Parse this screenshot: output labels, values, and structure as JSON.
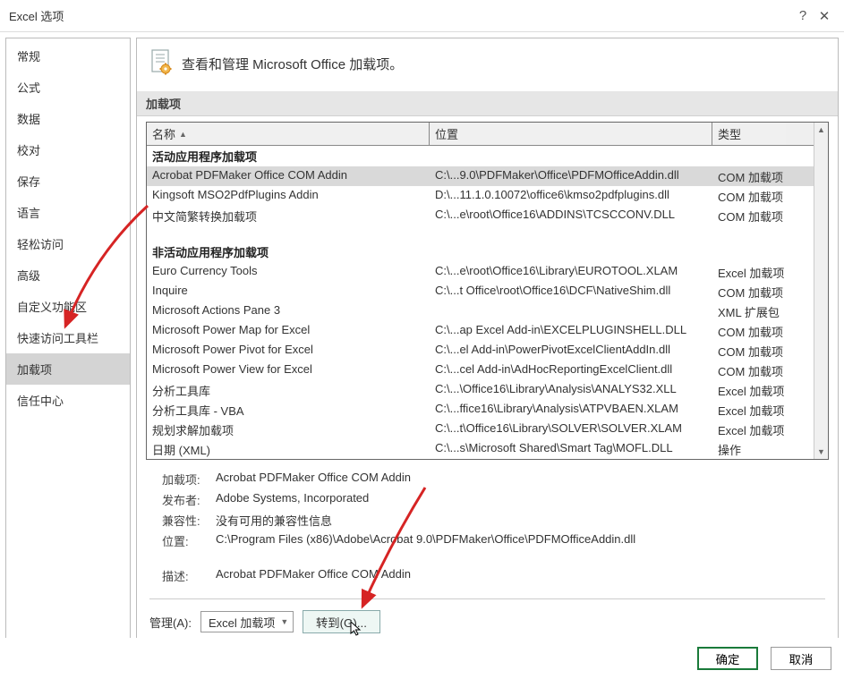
{
  "window": {
    "title": "Excel 选项",
    "help": "?",
    "close": "✕"
  },
  "sidebar": {
    "items": [
      {
        "label": "常规"
      },
      {
        "label": "公式"
      },
      {
        "label": "数据"
      },
      {
        "label": "校对"
      },
      {
        "label": "保存"
      },
      {
        "label": "语言"
      },
      {
        "label": "轻松访问"
      },
      {
        "label": "高级"
      },
      {
        "label": "自定义功能区"
      },
      {
        "label": "快速访问工具栏"
      },
      {
        "label": "加载项",
        "selected": true
      },
      {
        "label": "信任中心"
      }
    ]
  },
  "heading": "查看和管理 Microsoft Office 加载项。",
  "section_label": "加载项",
  "columns": {
    "name": "名称",
    "loc": "位置",
    "type": "类型",
    "sort": "▲"
  },
  "groups": [
    {
      "title": "活动应用程序加载项",
      "rows": [
        {
          "name": "Acrobat PDFMaker Office COM Addin",
          "loc": "C:\\...9.0\\PDFMaker\\Office\\PDFMOfficeAddin.dll",
          "type": "COM 加载项",
          "selected": true
        },
        {
          "name": "Kingsoft MSO2PdfPlugins Addin",
          "loc": "D:\\...11.1.0.10072\\office6\\kmso2pdfplugins.dll",
          "type": "COM 加载项"
        },
        {
          "name": "中文简繁转换加载项",
          "loc": "C:\\...e\\root\\Office16\\ADDINS\\TCSCCONV.DLL",
          "type": "COM 加载项"
        }
      ]
    },
    {
      "title": "非活动应用程序加载项",
      "rows": [
        {
          "name": "Euro Currency Tools",
          "loc": "C:\\...e\\root\\Office16\\Library\\EUROTOOL.XLAM",
          "type": "Excel 加载项"
        },
        {
          "name": "Inquire",
          "loc": "C:\\...t Office\\root\\Office16\\DCF\\NativeShim.dll",
          "type": "COM 加载项"
        },
        {
          "name": "Microsoft Actions Pane 3",
          "loc": "",
          "type": "XML 扩展包"
        },
        {
          "name": "Microsoft Power Map for Excel",
          "loc": "C:\\...ap Excel Add-in\\EXCELPLUGINSHELL.DLL",
          "type": "COM 加载项"
        },
        {
          "name": "Microsoft Power Pivot for Excel",
          "loc": "C:\\...el Add-in\\PowerPivotExcelClientAddIn.dll",
          "type": "COM 加载项"
        },
        {
          "name": "Microsoft Power View for Excel",
          "loc": "C:\\...cel Add-in\\AdHocReportingExcelClient.dll",
          "type": "COM 加载项"
        },
        {
          "name": "分析工具库",
          "loc": "C:\\...\\Office16\\Library\\Analysis\\ANALYS32.XLL",
          "type": "Excel 加载项"
        },
        {
          "name": "分析工具库 - VBA",
          "loc": "C:\\...ffice16\\Library\\Analysis\\ATPVBAEN.XLAM",
          "type": "Excel 加载项"
        },
        {
          "name": "规划求解加载项",
          "loc": "C:\\...t\\Office16\\Library\\SOLVER\\SOLVER.XLAM",
          "type": "Excel 加载项"
        },
        {
          "name": "日期 (XML)",
          "loc": "C:\\...s\\Microsoft Shared\\Smart Tag\\MOFL.DLL",
          "type": "操作"
        }
      ]
    }
  ],
  "details": {
    "labels": {
      "addin": "加载项:",
      "publisher": "发布者:",
      "compat": "兼容性:",
      "loc": "位置:",
      "desc": "描述:"
    },
    "addin": "Acrobat PDFMaker Office COM Addin",
    "publisher": "Adobe Systems, Incorporated",
    "compat": "没有可用的兼容性信息",
    "loc": "C:\\Program Files (x86)\\Adobe\\Acrobat 9.0\\PDFMaker\\Office\\PDFMOfficeAddin.dll",
    "desc": "Acrobat PDFMaker Office COM Addin"
  },
  "manage": {
    "label": "管理(A):",
    "select_value": "Excel 加载项",
    "go": "转到(G)..."
  },
  "footer": {
    "ok": "确定",
    "cancel": "取消"
  }
}
